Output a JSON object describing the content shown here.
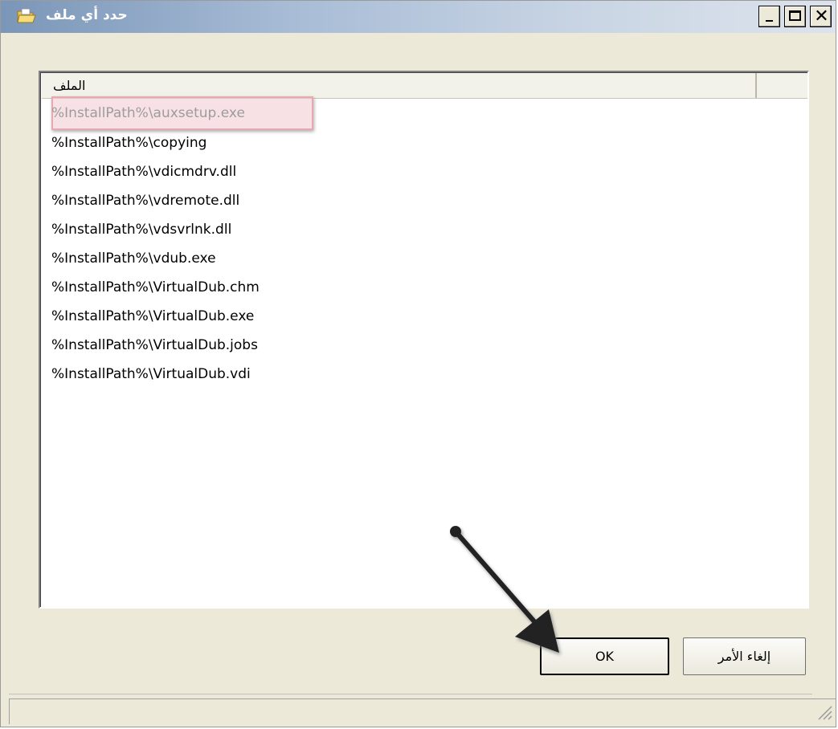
{
  "window": {
    "title": "حدد أي ملف",
    "icon": "folder-open-icon"
  },
  "titlebar_buttons": {
    "minimize": "minimize-icon",
    "maximize": "maximize-icon",
    "close": "✕"
  },
  "list": {
    "column_header": "الملف",
    "rows": [
      "%InstallPath%\\auxsetup.exe",
      "%InstallPath%\\copying",
      "%InstallPath%\\vdicmdrv.dll",
      "%InstallPath%\\vdremote.dll",
      "%InstallPath%\\vdsvrlnk.dll",
      "%InstallPath%\\vdub.exe",
      "%InstallPath%\\VirtualDub.chm",
      "%InstallPath%\\VirtualDub.exe",
      "%InstallPath%\\VirtualDub.jobs",
      "%InstallPath%\\VirtualDub.vdi"
    ]
  },
  "buttons": {
    "ok": "OK",
    "cancel": "إلغاء الأمر"
  },
  "colors": {
    "title_gradient_start": "#7a96b8",
    "highlight": "#f2c8ce",
    "window_bg": "#ece9d8"
  }
}
